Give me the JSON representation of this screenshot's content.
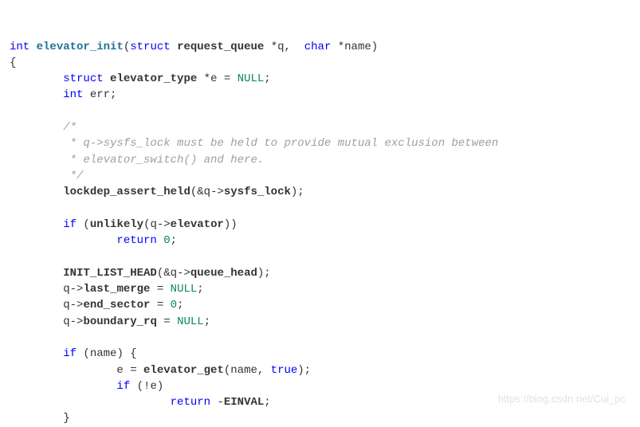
{
  "code": {
    "sig_kw_int": "int",
    "sig_fn": "elevator_init",
    "sig_kw_struct": "struct",
    "sig_type_rq": "request_queue",
    "sig_ptr_q": "*q,",
    "sig_kw_char": "char",
    "sig_ptr_name": "*name)",
    "brace_open": "{",
    "decl_struct": "struct",
    "decl_type_et": "elevator_type",
    "decl_ptr_e": "*e =",
    "decl_null1": "NULL",
    "decl_semi1": ";",
    "decl_int": "int",
    "decl_err": "err;",
    "cmt_open": "/*",
    "cmt_l1": " * q->sysfs_lock must be held to provide mutual exclusion between",
    "cmt_l2": " * elevator_switch() and here.",
    "cmt_close": " */",
    "lock_fn": "lockdep_assert_held",
    "lock_arg_open": "(&q->",
    "lock_field": "sysfs_lock",
    "lock_close": ");",
    "if1_if": "if",
    "if1_open": " (",
    "if1_unlikely": "unlikely",
    "if1_arg_open": "(q->",
    "if1_field": "elevator",
    "if1_close": "))",
    "if1_ret_kw": "return",
    "if1_ret_val": "0",
    "if1_ret_semi": ";",
    "ilh_fn": "INIT_LIST_HEAD",
    "ilh_arg_open": "(&q->",
    "ilh_field": "queue_head",
    "ilh_close": ");",
    "lm_pre": "q->",
    "lm_field": "last_merge",
    "lm_eq": " = ",
    "lm_null": "NULL",
    "lm_semi": ";",
    "es_pre": "q->",
    "es_field": "end_sector",
    "es_eq": " = ",
    "es_val": "0",
    "es_semi": ";",
    "br_pre": "q->",
    "br_field": "boundary_rq",
    "br_eq": " = ",
    "br_null": "NULL",
    "br_semi": ";",
    "if2_if": "if",
    "if2_cond": " (name) {",
    "eget_lhs": "e = ",
    "eget_fn": "elevator_get",
    "eget_args_open": "(name, ",
    "eget_true": "true",
    "eget_close": ");",
    "if3_if": "if",
    "if3_cond": " (!e)",
    "if3_ret_kw": "return",
    "if3_neg": " -",
    "if3_einval": "EINVAL",
    "if3_semi": ";",
    "brace_close_inner": "}"
  },
  "watermark": "https://blog.csdn.net/Cui_pc"
}
